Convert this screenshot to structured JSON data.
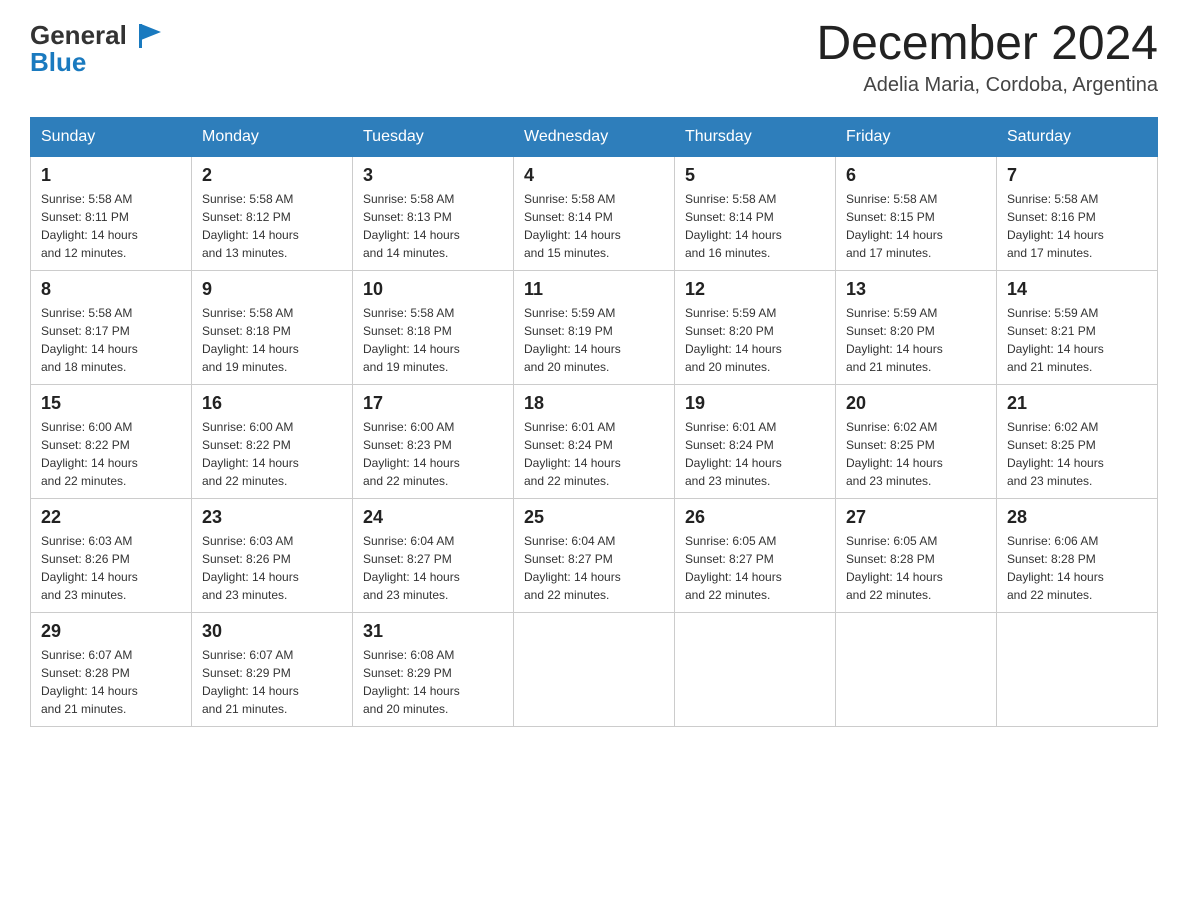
{
  "header": {
    "logo_line1": "General",
    "logo_line2": "Blue",
    "month": "December 2024",
    "location": "Adelia Maria, Cordoba, Argentina"
  },
  "weekdays": [
    "Sunday",
    "Monday",
    "Tuesday",
    "Wednesday",
    "Thursday",
    "Friday",
    "Saturday"
  ],
  "weeks": [
    [
      {
        "day": "1",
        "sunrise": "5:58 AM",
        "sunset": "8:11 PM",
        "daylight": "14 hours and 12 minutes."
      },
      {
        "day": "2",
        "sunrise": "5:58 AM",
        "sunset": "8:12 PM",
        "daylight": "14 hours and 13 minutes."
      },
      {
        "day": "3",
        "sunrise": "5:58 AM",
        "sunset": "8:13 PM",
        "daylight": "14 hours and 14 minutes."
      },
      {
        "day": "4",
        "sunrise": "5:58 AM",
        "sunset": "8:14 PM",
        "daylight": "14 hours and 15 minutes."
      },
      {
        "day": "5",
        "sunrise": "5:58 AM",
        "sunset": "8:14 PM",
        "daylight": "14 hours and 16 minutes."
      },
      {
        "day": "6",
        "sunrise": "5:58 AM",
        "sunset": "8:15 PM",
        "daylight": "14 hours and 17 minutes."
      },
      {
        "day": "7",
        "sunrise": "5:58 AM",
        "sunset": "8:16 PM",
        "daylight": "14 hours and 17 minutes."
      }
    ],
    [
      {
        "day": "8",
        "sunrise": "5:58 AM",
        "sunset": "8:17 PM",
        "daylight": "14 hours and 18 minutes."
      },
      {
        "day": "9",
        "sunrise": "5:58 AM",
        "sunset": "8:18 PM",
        "daylight": "14 hours and 19 minutes."
      },
      {
        "day": "10",
        "sunrise": "5:58 AM",
        "sunset": "8:18 PM",
        "daylight": "14 hours and 19 minutes."
      },
      {
        "day": "11",
        "sunrise": "5:59 AM",
        "sunset": "8:19 PM",
        "daylight": "14 hours and 20 minutes."
      },
      {
        "day": "12",
        "sunrise": "5:59 AM",
        "sunset": "8:20 PM",
        "daylight": "14 hours and 20 minutes."
      },
      {
        "day": "13",
        "sunrise": "5:59 AM",
        "sunset": "8:20 PM",
        "daylight": "14 hours and 21 minutes."
      },
      {
        "day": "14",
        "sunrise": "5:59 AM",
        "sunset": "8:21 PM",
        "daylight": "14 hours and 21 minutes."
      }
    ],
    [
      {
        "day": "15",
        "sunrise": "6:00 AM",
        "sunset": "8:22 PM",
        "daylight": "14 hours and 22 minutes."
      },
      {
        "day": "16",
        "sunrise": "6:00 AM",
        "sunset": "8:22 PM",
        "daylight": "14 hours and 22 minutes."
      },
      {
        "day": "17",
        "sunrise": "6:00 AM",
        "sunset": "8:23 PM",
        "daylight": "14 hours and 22 minutes."
      },
      {
        "day": "18",
        "sunrise": "6:01 AM",
        "sunset": "8:24 PM",
        "daylight": "14 hours and 22 minutes."
      },
      {
        "day": "19",
        "sunrise": "6:01 AM",
        "sunset": "8:24 PM",
        "daylight": "14 hours and 23 minutes."
      },
      {
        "day": "20",
        "sunrise": "6:02 AM",
        "sunset": "8:25 PM",
        "daylight": "14 hours and 23 minutes."
      },
      {
        "day": "21",
        "sunrise": "6:02 AM",
        "sunset": "8:25 PM",
        "daylight": "14 hours and 23 minutes."
      }
    ],
    [
      {
        "day": "22",
        "sunrise": "6:03 AM",
        "sunset": "8:26 PM",
        "daylight": "14 hours and 23 minutes."
      },
      {
        "day": "23",
        "sunrise": "6:03 AM",
        "sunset": "8:26 PM",
        "daylight": "14 hours and 23 minutes."
      },
      {
        "day": "24",
        "sunrise": "6:04 AM",
        "sunset": "8:27 PM",
        "daylight": "14 hours and 23 minutes."
      },
      {
        "day": "25",
        "sunrise": "6:04 AM",
        "sunset": "8:27 PM",
        "daylight": "14 hours and 22 minutes."
      },
      {
        "day": "26",
        "sunrise": "6:05 AM",
        "sunset": "8:27 PM",
        "daylight": "14 hours and 22 minutes."
      },
      {
        "day": "27",
        "sunrise": "6:05 AM",
        "sunset": "8:28 PM",
        "daylight": "14 hours and 22 minutes."
      },
      {
        "day": "28",
        "sunrise": "6:06 AM",
        "sunset": "8:28 PM",
        "daylight": "14 hours and 22 minutes."
      }
    ],
    [
      {
        "day": "29",
        "sunrise": "6:07 AM",
        "sunset": "8:28 PM",
        "daylight": "14 hours and 21 minutes."
      },
      {
        "day": "30",
        "sunrise": "6:07 AM",
        "sunset": "8:29 PM",
        "daylight": "14 hours and 21 minutes."
      },
      {
        "day": "31",
        "sunrise": "6:08 AM",
        "sunset": "8:29 PM",
        "daylight": "14 hours and 20 minutes."
      },
      null,
      null,
      null,
      null
    ]
  ],
  "labels": {
    "sunrise": "Sunrise:",
    "sunset": "Sunset:",
    "daylight": "Daylight:"
  }
}
